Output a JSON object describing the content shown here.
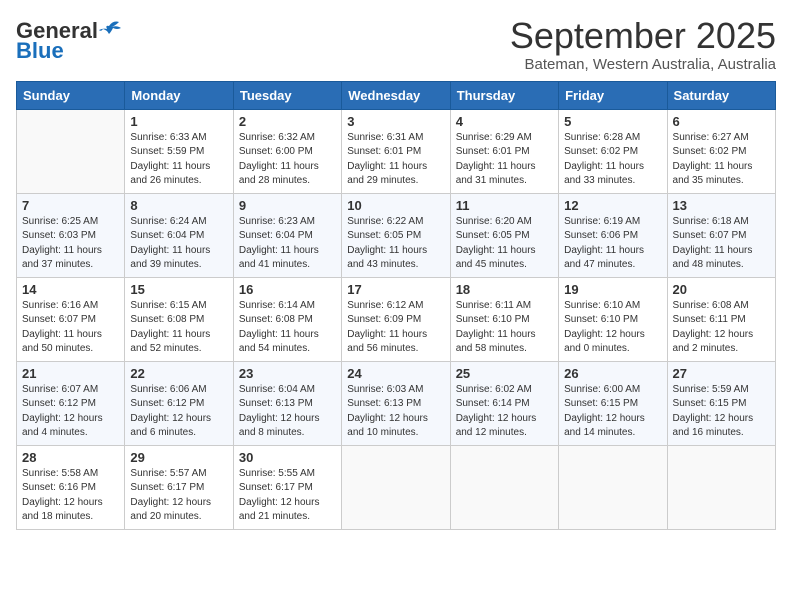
{
  "header": {
    "logo_general": "General",
    "logo_blue": "Blue",
    "month_title": "September 2025",
    "location": "Bateman, Western Australia, Australia"
  },
  "calendar": {
    "headers": [
      "Sunday",
      "Monday",
      "Tuesday",
      "Wednesday",
      "Thursday",
      "Friday",
      "Saturday"
    ],
    "rows": [
      [
        {
          "day": "",
          "info": ""
        },
        {
          "day": "1",
          "info": "Sunrise: 6:33 AM\nSunset: 5:59 PM\nDaylight: 11 hours\nand 26 minutes."
        },
        {
          "day": "2",
          "info": "Sunrise: 6:32 AM\nSunset: 6:00 PM\nDaylight: 11 hours\nand 28 minutes."
        },
        {
          "day": "3",
          "info": "Sunrise: 6:31 AM\nSunset: 6:01 PM\nDaylight: 11 hours\nand 29 minutes."
        },
        {
          "day": "4",
          "info": "Sunrise: 6:29 AM\nSunset: 6:01 PM\nDaylight: 11 hours\nand 31 minutes."
        },
        {
          "day": "5",
          "info": "Sunrise: 6:28 AM\nSunset: 6:02 PM\nDaylight: 11 hours\nand 33 minutes."
        },
        {
          "day": "6",
          "info": "Sunrise: 6:27 AM\nSunset: 6:02 PM\nDaylight: 11 hours\nand 35 minutes."
        }
      ],
      [
        {
          "day": "7",
          "info": "Sunrise: 6:25 AM\nSunset: 6:03 PM\nDaylight: 11 hours\nand 37 minutes."
        },
        {
          "day": "8",
          "info": "Sunrise: 6:24 AM\nSunset: 6:04 PM\nDaylight: 11 hours\nand 39 minutes."
        },
        {
          "day": "9",
          "info": "Sunrise: 6:23 AM\nSunset: 6:04 PM\nDaylight: 11 hours\nand 41 minutes."
        },
        {
          "day": "10",
          "info": "Sunrise: 6:22 AM\nSunset: 6:05 PM\nDaylight: 11 hours\nand 43 minutes."
        },
        {
          "day": "11",
          "info": "Sunrise: 6:20 AM\nSunset: 6:05 PM\nDaylight: 11 hours\nand 45 minutes."
        },
        {
          "day": "12",
          "info": "Sunrise: 6:19 AM\nSunset: 6:06 PM\nDaylight: 11 hours\nand 47 minutes."
        },
        {
          "day": "13",
          "info": "Sunrise: 6:18 AM\nSunset: 6:07 PM\nDaylight: 11 hours\nand 48 minutes."
        }
      ],
      [
        {
          "day": "14",
          "info": "Sunrise: 6:16 AM\nSunset: 6:07 PM\nDaylight: 11 hours\nand 50 minutes."
        },
        {
          "day": "15",
          "info": "Sunrise: 6:15 AM\nSunset: 6:08 PM\nDaylight: 11 hours\nand 52 minutes."
        },
        {
          "day": "16",
          "info": "Sunrise: 6:14 AM\nSunset: 6:08 PM\nDaylight: 11 hours\nand 54 minutes."
        },
        {
          "day": "17",
          "info": "Sunrise: 6:12 AM\nSunset: 6:09 PM\nDaylight: 11 hours\nand 56 minutes."
        },
        {
          "day": "18",
          "info": "Sunrise: 6:11 AM\nSunset: 6:10 PM\nDaylight: 11 hours\nand 58 minutes."
        },
        {
          "day": "19",
          "info": "Sunrise: 6:10 AM\nSunset: 6:10 PM\nDaylight: 12 hours\nand 0 minutes."
        },
        {
          "day": "20",
          "info": "Sunrise: 6:08 AM\nSunset: 6:11 PM\nDaylight: 12 hours\nand 2 minutes."
        }
      ],
      [
        {
          "day": "21",
          "info": "Sunrise: 6:07 AM\nSunset: 6:12 PM\nDaylight: 12 hours\nand 4 minutes."
        },
        {
          "day": "22",
          "info": "Sunrise: 6:06 AM\nSunset: 6:12 PM\nDaylight: 12 hours\nand 6 minutes."
        },
        {
          "day": "23",
          "info": "Sunrise: 6:04 AM\nSunset: 6:13 PM\nDaylight: 12 hours\nand 8 minutes."
        },
        {
          "day": "24",
          "info": "Sunrise: 6:03 AM\nSunset: 6:13 PM\nDaylight: 12 hours\nand 10 minutes."
        },
        {
          "day": "25",
          "info": "Sunrise: 6:02 AM\nSunset: 6:14 PM\nDaylight: 12 hours\nand 12 minutes."
        },
        {
          "day": "26",
          "info": "Sunrise: 6:00 AM\nSunset: 6:15 PM\nDaylight: 12 hours\nand 14 minutes."
        },
        {
          "day": "27",
          "info": "Sunrise: 5:59 AM\nSunset: 6:15 PM\nDaylight: 12 hours\nand 16 minutes."
        }
      ],
      [
        {
          "day": "28",
          "info": "Sunrise: 5:58 AM\nSunset: 6:16 PM\nDaylight: 12 hours\nand 18 minutes."
        },
        {
          "day": "29",
          "info": "Sunrise: 5:57 AM\nSunset: 6:17 PM\nDaylight: 12 hours\nand 20 minutes."
        },
        {
          "day": "30",
          "info": "Sunrise: 5:55 AM\nSunset: 6:17 PM\nDaylight: 12 hours\nand 21 minutes."
        },
        {
          "day": "",
          "info": ""
        },
        {
          "day": "",
          "info": ""
        },
        {
          "day": "",
          "info": ""
        },
        {
          "day": "",
          "info": ""
        }
      ]
    ]
  }
}
